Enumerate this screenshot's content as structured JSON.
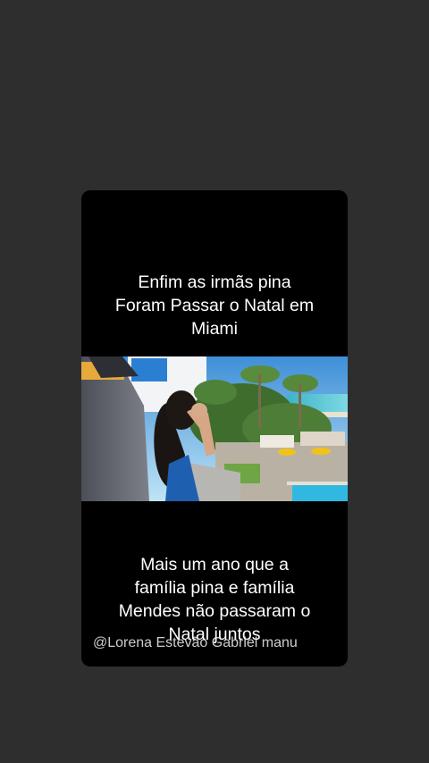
{
  "story": {
    "top_caption": "Enfim as irmãs pina\nForam Passar o Natal em\nMiami",
    "bottom_caption": "Mais um ano que a\nfamília pina e família\nMendes não passaram o\nNatal juntos",
    "credit": "@Lorena Estevão Gabriel manu"
  },
  "colors": {
    "background": "#2f2e2e",
    "card": "#000000",
    "text": "#ffffff"
  }
}
